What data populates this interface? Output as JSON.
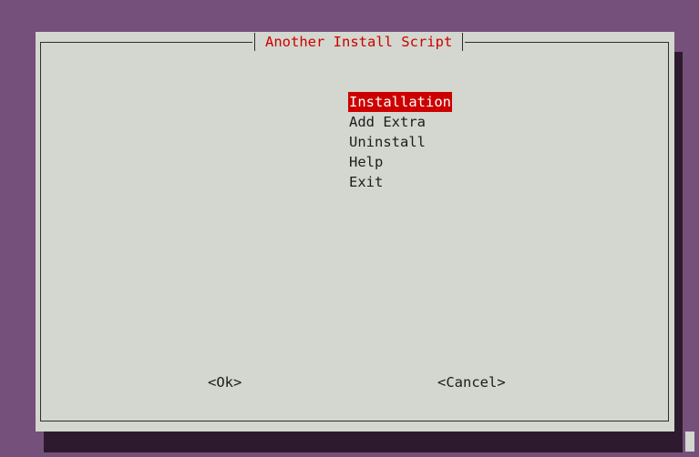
{
  "dialog": {
    "title": "Another Install Script"
  },
  "menu": {
    "items": [
      {
        "label": "Installation",
        "selected": true
      },
      {
        "label": "Add Extra",
        "selected": false
      },
      {
        "label": "Uninstall",
        "selected": false
      },
      {
        "label": "Help",
        "selected": false
      },
      {
        "label": "Exit",
        "selected": false
      }
    ]
  },
  "buttons": {
    "ok_label": "<Ok>",
    "cancel_label": "<Cancel>"
  },
  "colors": {
    "background": "#75507b",
    "dialog": "#d3d7cf",
    "title": "#cc0000",
    "highlight": "#cc0000"
  }
}
